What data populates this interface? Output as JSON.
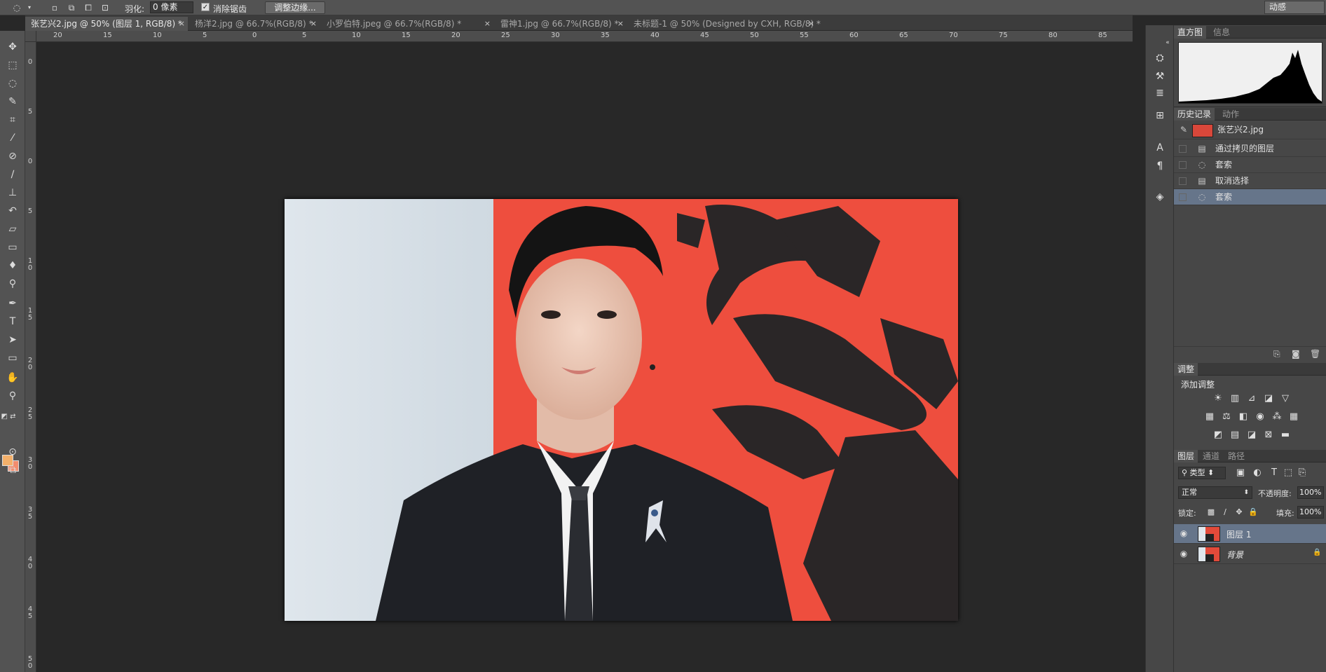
{
  "options_bar": {
    "feather_label": "羽化:",
    "feather_value": "0 像素",
    "antialias_label": "消除锯齿",
    "refine_edge_label": "调整边缘...",
    "workspace_label": "动感"
  },
  "tabs": [
    {
      "label": "张艺兴2.jpg @ 50% (图层 1, RGB/8) *",
      "close": "×"
    },
    {
      "label": "杨洋2.jpg @ 66.7%(RGB/8) *",
      "close": "×"
    },
    {
      "label": "小罗伯特.jpeg @ 66.7%(RGB/8) *",
      "close": "×"
    },
    {
      "label": "雷神1.jpg @ 66.7%(RGB/8) *",
      "close": "×"
    },
    {
      "label": "未标题-1 @ 50% (Designed by CXH, RGB/8) *",
      "close": "×"
    }
  ],
  "ruler": {
    "h_ticks": [
      "20",
      "15",
      "10",
      "5",
      "0",
      "5",
      "10",
      "15",
      "20",
      "25",
      "30",
      "35",
      "40",
      "45",
      "50",
      "55",
      "60",
      "65",
      "70",
      "75",
      "80",
      "85"
    ],
    "v_ticks": [
      "0",
      "5",
      "0",
      "5",
      "1\n0",
      "1\n5",
      "2\n0",
      "2\n5",
      "3\n0",
      "3\n5",
      "4\n0",
      "4\n5",
      "5\n0"
    ]
  },
  "panels": {
    "histogram": {
      "tabs": [
        "直方图",
        "信息"
      ]
    },
    "history": {
      "tabs": [
        "历史记录",
        "动作"
      ],
      "snapshot": "张艺兴2.jpg",
      "items": [
        {
          "label": "通过拷贝的图层",
          "icon": "layer-doc-icon"
        },
        {
          "label": "套索",
          "icon": "lasso-icon"
        },
        {
          "label": "取消选择",
          "icon": "layer-doc-icon"
        },
        {
          "label": "套索",
          "icon": "lasso-icon"
        }
      ]
    },
    "adjustments": {
      "tab": "调整",
      "title": "添加调整"
    },
    "layers": {
      "tabs": [
        "图层",
        "通道",
        "路径"
      ],
      "filter_kind": "类型",
      "blend_mode": "正常",
      "opacity_label": "不透明度:",
      "opacity_value": "100%",
      "lock_label": "锁定:",
      "fill_label": "填充:",
      "fill_value": "100%",
      "items": [
        {
          "name": "图层 1"
        },
        {
          "name": "背景"
        }
      ]
    }
  },
  "colors": {
    "foreground": "#f4b06a",
    "background": "#f28d6e",
    "selection": "#66758a"
  }
}
